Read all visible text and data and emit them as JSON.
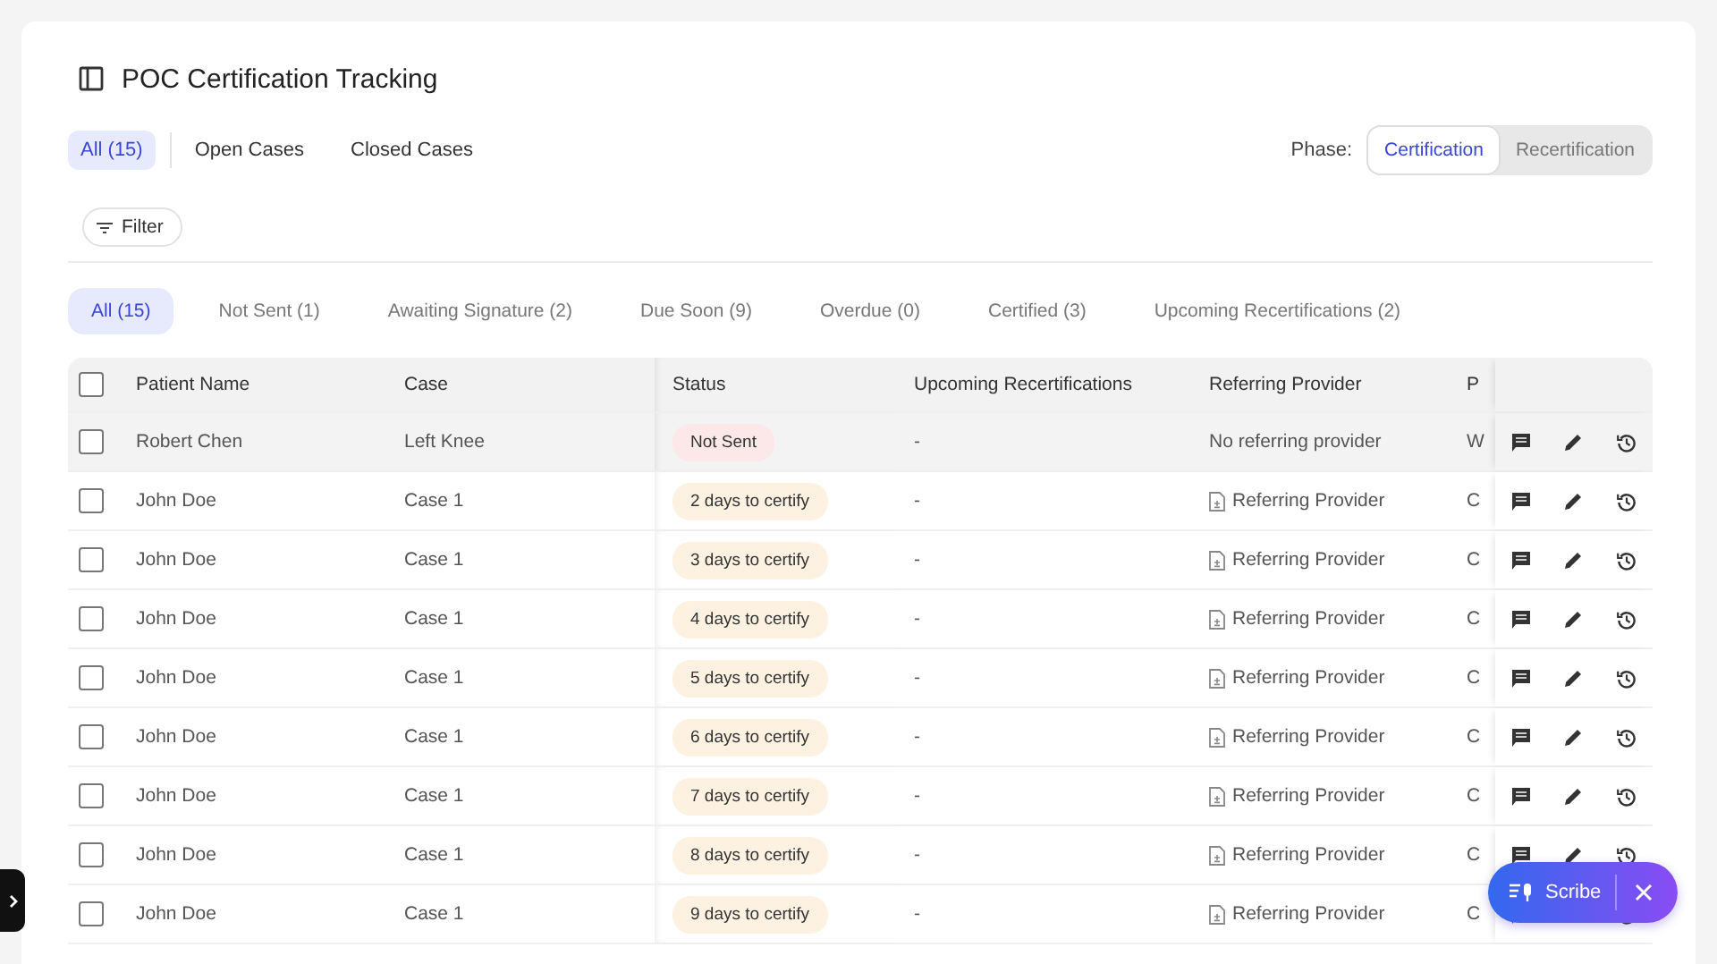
{
  "header": {
    "title": "POC Certification Tracking"
  },
  "case_tabs": [
    {
      "label": "All (15)",
      "selected": true
    },
    {
      "label": "Open Cases",
      "selected": false
    },
    {
      "label": "Closed Cases",
      "selected": false
    }
  ],
  "phase": {
    "label": "Phase:",
    "options": [
      {
        "label": "Certification",
        "selected": true
      },
      {
        "label": "Recertification",
        "selected": false
      }
    ]
  },
  "filter_button": {
    "label": "Filter"
  },
  "status_tabs": [
    {
      "label": "All (15)",
      "selected": true
    },
    {
      "label": "Not Sent (1)",
      "selected": false
    },
    {
      "label": "Awaiting Signature (2)",
      "selected": false
    },
    {
      "label": "Due Soon (9)",
      "selected": false
    },
    {
      "label": "Overdue (0)",
      "selected": false
    },
    {
      "label": "Certified (3)",
      "selected": false
    },
    {
      "label": "Upcoming Recertifications (2)",
      "selected": false
    }
  ],
  "table": {
    "columns": [
      "Patient Name",
      "Case",
      "Status",
      "Upcoming Recertifications",
      "Referring Provider",
      "P"
    ],
    "header_checked": false,
    "rows": [
      {
        "patient": "Robert Chen",
        "case": "Left Knee",
        "status": {
          "text": "Not Sent",
          "color": "#fce8e8"
        },
        "upcoming": "-",
        "provider": "No referring provider",
        "provider_linked": false,
        "column_6": "W",
        "checked": false,
        "highlighted": true
      },
      {
        "patient": "John Doe",
        "case": "Case 1",
        "status": {
          "text": "2 days to certify",
          "color": "#fdf1e1"
        },
        "upcoming": "-",
        "provider": "Referring Provider",
        "provider_linked": true,
        "column_6": "C",
        "checked": false,
        "highlighted": false
      },
      {
        "patient": "John Doe",
        "case": "Case 1",
        "status": {
          "text": "3 days to certify",
          "color": "#fdf1e1"
        },
        "upcoming": "-",
        "provider": "Referring Provider",
        "provider_linked": true,
        "column_6": "C",
        "checked": false,
        "highlighted": false
      },
      {
        "patient": "John Doe",
        "case": "Case 1",
        "status": {
          "text": "4 days to certify",
          "color": "#fdf1e1"
        },
        "upcoming": "-",
        "provider": "Referring Provider",
        "provider_linked": true,
        "column_6": "C",
        "checked": false,
        "highlighted": false
      },
      {
        "patient": "John Doe",
        "case": "Case 1",
        "status": {
          "text": "5 days to certify",
          "color": "#fdf1e1"
        },
        "upcoming": "-",
        "provider": "Referring Provider",
        "provider_linked": true,
        "column_6": "C",
        "checked": false,
        "highlighted": false
      },
      {
        "patient": "John Doe",
        "case": "Case 1",
        "status": {
          "text": "6 days to certify",
          "color": "#fdf1e1"
        },
        "upcoming": "-",
        "provider": "Referring Provider",
        "provider_linked": true,
        "column_6": "C",
        "checked": false,
        "highlighted": false
      },
      {
        "patient": "John Doe",
        "case": "Case 1",
        "status": {
          "text": "7 days to certify",
          "color": "#fdf1e1"
        },
        "upcoming": "-",
        "provider": "Referring Provider",
        "provider_linked": true,
        "column_6": "C",
        "checked": false,
        "highlighted": false
      },
      {
        "patient": "John Doe",
        "case": "Case 1",
        "status": {
          "text": "8 days to certify",
          "color": "#fdf1e1"
        },
        "upcoming": "-",
        "provider": "Referring Provider",
        "provider_linked": true,
        "column_6": "C",
        "checked": false,
        "highlighted": false
      },
      {
        "patient": "John Doe",
        "case": "Case 1",
        "status": {
          "text": "9 days to certify",
          "color": "#fdf1e1"
        },
        "upcoming": "-",
        "provider": "Referring Provider",
        "provider_linked": true,
        "column_6": "C",
        "checked": false,
        "highlighted": false
      }
    ]
  },
  "scribe_button": {
    "label": "Scribe"
  }
}
